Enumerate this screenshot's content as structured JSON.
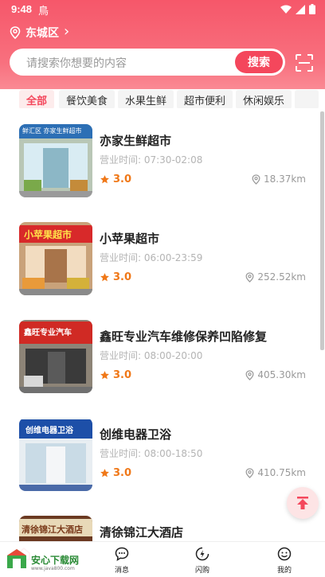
{
  "status_bar": {
    "time": "9:48",
    "app_glyph": "鳥"
  },
  "location": {
    "label": "东城区",
    "chevron": "›"
  },
  "search": {
    "placeholder": "请搜索你想要的内容",
    "button_label": "搜索"
  },
  "categories": [
    {
      "label": "全部",
      "active": true
    },
    {
      "label": "餐饮美食",
      "active": false
    },
    {
      "label": "水果生鲜",
      "active": false
    },
    {
      "label": "超市便利",
      "active": false
    },
    {
      "label": "休闲娱乐",
      "active": false
    }
  ],
  "stores": [
    {
      "name": "亦家生鲜超市",
      "hours": "营业时间: 07:30-02:08",
      "rating": "3.0",
      "distance": "18.37km",
      "sign_text": "鲜汇区 亦家生鲜超市",
      "sign_color": "#2c6fb5",
      "sign_text_color": "#ffffff"
    },
    {
      "name": "小苹果超市",
      "hours": "营业时间: 06:00-23:59",
      "rating": "3.0",
      "distance": "252.52km",
      "sign_text": "小苹果超市",
      "sign_color": "#d8292a",
      "sign_text_color": "#ffe24a"
    },
    {
      "name": "鑫旺专业汽车维修保养凹陷修复",
      "hours": "营业时间: 08:00-20:00",
      "rating": "3.0",
      "distance": "405.30km",
      "sign_text": "鑫旺专业汽车",
      "sign_color": "#d02a24",
      "sign_text_color": "#ffffff"
    },
    {
      "name": "创维电器卫浴",
      "hours": "营业时间: 08:00-18:50",
      "rating": "3.0",
      "distance": "410.75km",
      "sign_text": "创维电器卫浴",
      "sign_color": "#1d4fa8",
      "sign_text_color": "#ffffff"
    },
    {
      "name": "清徐锦江大酒店",
      "hours": "",
      "rating": "",
      "distance": "",
      "sign_text": "清徐锦江大酒店",
      "sign_color": "#e8d9b8",
      "sign_text_color": "#7a3a1a"
    }
  ],
  "tabbar": [
    {
      "label": "",
      "icon": "home-icon"
    },
    {
      "label": "消息",
      "icon": "message-icon"
    },
    {
      "label": "闪购",
      "icon": "flash-icon"
    },
    {
      "label": "我的",
      "icon": "profile-icon"
    }
  ],
  "watermark": {
    "text": "安心下载网",
    "url": "www.java800.com"
  },
  "colors": {
    "brand": "#f4475c",
    "rating": "#f07818"
  }
}
